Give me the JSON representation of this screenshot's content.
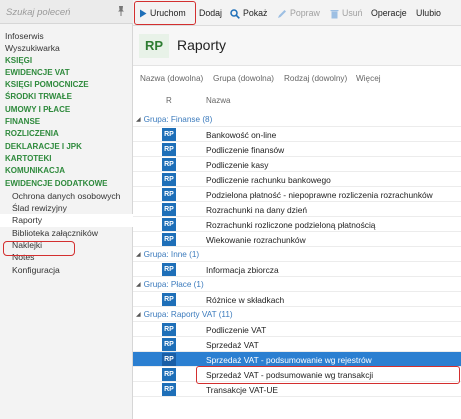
{
  "search": {
    "placeholder": "Szukaj poleceń"
  },
  "sidebar": {
    "items": [
      {
        "label": "Infoserwis",
        "kind": "link"
      },
      {
        "label": "Wyszukiwarka",
        "kind": "link"
      },
      {
        "label": "KSIĘGI",
        "kind": "cat"
      },
      {
        "label": "EWIDENCJE VAT",
        "kind": "cat"
      },
      {
        "label": "KSIĘGI POMOCNICZE",
        "kind": "cat"
      },
      {
        "label": "ŚRODKI TRWAŁE",
        "kind": "cat"
      },
      {
        "label": "UMOWY I PŁACE",
        "kind": "cat"
      },
      {
        "label": "FINANSE",
        "kind": "cat"
      },
      {
        "label": "ROZLICZENIA",
        "kind": "cat"
      },
      {
        "label": "DEKLARACJE I JPK",
        "kind": "cat"
      },
      {
        "label": "KARTOTEKI",
        "kind": "cat"
      },
      {
        "label": "KOMUNIKACJA",
        "kind": "cat"
      },
      {
        "label": "EWIDENCJE DODATKOWE",
        "kind": "cat"
      },
      {
        "label": "Ochrona danych osobowych",
        "kind": "sub"
      },
      {
        "label": "Ślad rewizyjny",
        "kind": "sub"
      },
      {
        "label": "Raporty",
        "kind": "sub",
        "active": true
      },
      {
        "label": "Biblioteka załączników",
        "kind": "sub"
      },
      {
        "label": "Naklejki",
        "kind": "sub"
      },
      {
        "label": "Notes",
        "kind": "sub"
      },
      {
        "label": "Konfiguracja",
        "kind": "sub"
      }
    ]
  },
  "toolbar": {
    "run": "Uruchom",
    "add": "Dodaj",
    "show": "Pokaż",
    "edit": "Popraw",
    "delete": "Usuń",
    "operations": "Operacje",
    "favorites": "Ulubio"
  },
  "header": {
    "badge": "RP",
    "title": "Raporty"
  },
  "filters": {
    "name": "Nazwa (dowolna)",
    "group": "Grupa (dowolna)",
    "kind": "Rodzaj (dowolny)",
    "more": "Więcej"
  },
  "columns": {
    "r": "R",
    "name": "Nazwa"
  },
  "rows": [
    {
      "type": "group",
      "label": "Grupa: Finanse (8)"
    },
    {
      "type": "item",
      "badge": "RP",
      "name": "Bankowość on-line"
    },
    {
      "type": "item",
      "badge": "RP",
      "name": "Podliczenie finansów"
    },
    {
      "type": "item",
      "badge": "RP",
      "name": "Podliczenie kasy"
    },
    {
      "type": "item",
      "badge": "RP",
      "name": "Podliczenie rachunku bankowego"
    },
    {
      "type": "item",
      "badge": "RP",
      "name": "Podzielona płatność - niepoprawne rozliczenia rozrachunków"
    },
    {
      "type": "item",
      "badge": "RP",
      "name": "Rozrachunki na dany dzień"
    },
    {
      "type": "item",
      "badge": "RP",
      "name": "Rozrachunki rozliczone podzieloną płatnością"
    },
    {
      "type": "item",
      "badge": "RP",
      "name": "Wiekowanie rozrachunków"
    },
    {
      "type": "group",
      "label": "Grupa: Inne (1)"
    },
    {
      "type": "item",
      "badge": "RP",
      "name": "Informacja zbiorcza"
    },
    {
      "type": "group",
      "label": "Grupa: Płace (1)"
    },
    {
      "type": "item",
      "badge": "RP",
      "name": "Różnice w składkach"
    },
    {
      "type": "group",
      "label": "Grupa: Raporty VAT (11)"
    },
    {
      "type": "item",
      "badge": "RP",
      "name": "Podliczenie VAT"
    },
    {
      "type": "item",
      "badge": "RP",
      "name": "Sprzedaż VAT"
    },
    {
      "type": "item",
      "badge": "RP",
      "name": "Sprzedaż VAT - podsumowanie wg rejestrów",
      "selected": true
    },
    {
      "type": "item",
      "badge": "RP",
      "name": "Sprzedaż VAT - podsumowanie wg transakcji"
    },
    {
      "type": "item",
      "badge": "RP",
      "name": "Transakcje VAT-UE"
    }
  ],
  "colors": {
    "accent": "#2b7fd1",
    "category": "#2e8a3c",
    "highlight": "#d32f2f",
    "badge": "#1e6fb8"
  },
  "icons": {
    "run": "play-icon",
    "show": "search-icon",
    "edit": "pencil-icon",
    "delete": "trash-icon",
    "pin": "pin-icon",
    "group_toggle": "triangle-down-icon"
  }
}
